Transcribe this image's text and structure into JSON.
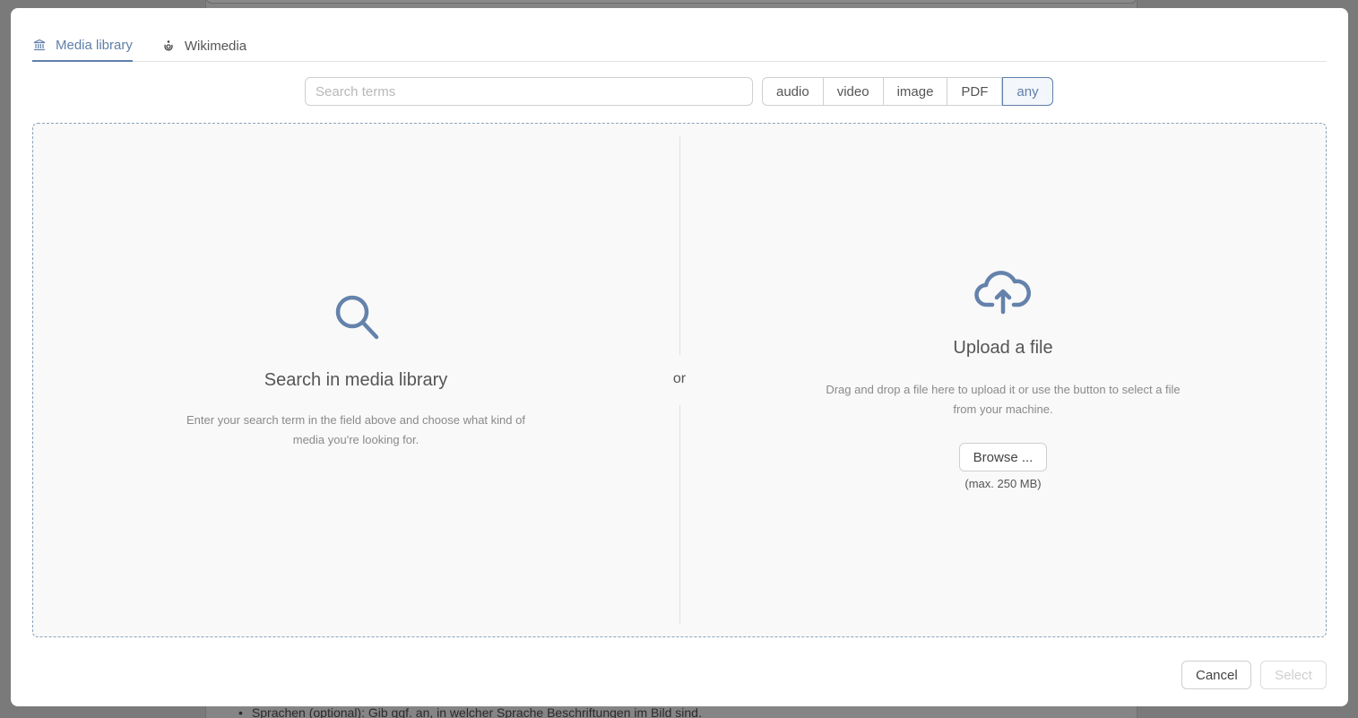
{
  "background": {
    "list_item": "Sprachen (optional): Gib ggf. an, in welcher Sprache Beschriftungen im Bild sind."
  },
  "tabs": [
    {
      "label": "Media library",
      "icon": "museum-icon",
      "active": true
    },
    {
      "label": "Wikimedia",
      "icon": "wikimedia-icon",
      "active": false
    }
  ],
  "search": {
    "placeholder": "Search terms",
    "value": ""
  },
  "filters": [
    {
      "label": "audio",
      "active": false
    },
    {
      "label": "video",
      "active": false
    },
    {
      "label": "image",
      "active": false
    },
    {
      "label": "PDF",
      "active": false
    },
    {
      "label": "any",
      "active": true
    }
  ],
  "library_pane": {
    "icon": "search-icon",
    "title": "Search in media library",
    "description": "Enter your search term in the field above and choose what kind of media you're looking for."
  },
  "separator": "or",
  "upload_pane": {
    "icon": "cloud-upload-icon",
    "title": "Upload a file",
    "description": "Drag and drop a file here to upload it or use the button to select a file from your machine.",
    "button_label": "Browse ...",
    "max_note": "(max. 250 MB)"
  },
  "footer": {
    "cancel_label": "Cancel",
    "select_label": "Select"
  },
  "colors": {
    "accent": "#5f7fa8",
    "overlay": "#7a7a7a",
    "dropzone_border": "#8aa3b8"
  }
}
